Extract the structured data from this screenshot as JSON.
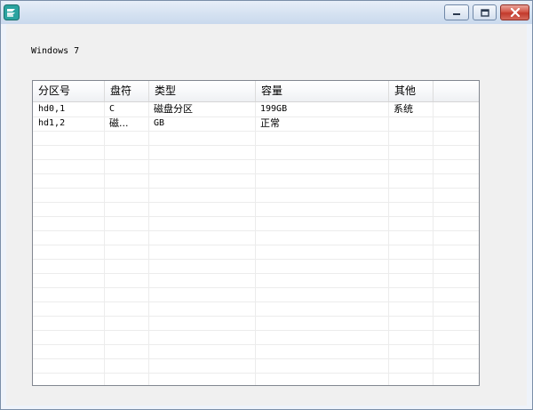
{
  "window": {
    "title": "",
    "buttons": {
      "minimize": "minimize",
      "maximize": "maximize",
      "close": "close"
    }
  },
  "os_label": "Windows 7",
  "table": {
    "columns": [
      "分区号",
      "盘符",
      "类型",
      "容量",
      "其他"
    ],
    "rows": [
      [
        "hd0,1",
        "C",
        "磁盘分区",
        "199GB",
        "系统"
      ],
      [
        "hd1,2",
        "磁...",
        "GB",
        "正常",
        ""
      ]
    ]
  }
}
